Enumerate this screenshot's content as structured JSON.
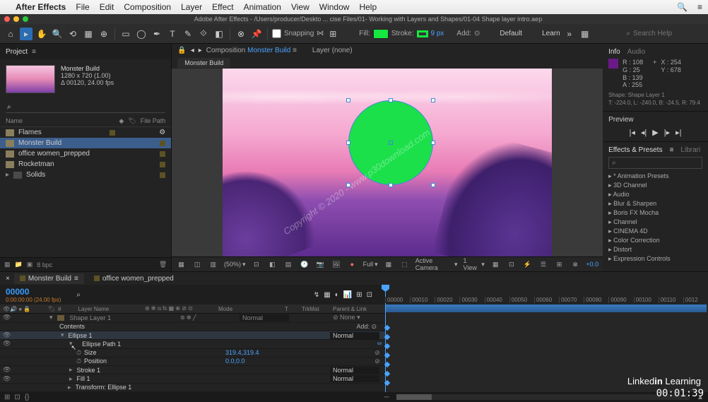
{
  "macos_menu": {
    "app": "After Effects",
    "items": [
      "File",
      "Edit",
      "Composition",
      "Layer",
      "Effect",
      "Animation",
      "View",
      "Window",
      "Help"
    ]
  },
  "title_bar": "Adobe After Effects - /Users/producer/Deskto ... cise Files/01- Working with Layers and Shapes/01-04 Shape layer intro.aep",
  "toolbar": {
    "snapping": "Snapping",
    "fill": "Fill:",
    "stroke": "Stroke:",
    "stroke_px": "9 px",
    "add": "Add:",
    "workspace1": "Default",
    "workspace2": "Learn",
    "search_placeholder": "Search Help"
  },
  "project": {
    "tab": "Project",
    "comp_name": "Monster Build",
    "comp_dims": "1280 x 720 (1.00)",
    "comp_dur": "Δ 00120, 24.00 fps",
    "header_name": "Name",
    "header_path": "File Path",
    "items": [
      {
        "name": "Flames",
        "type": "comp"
      },
      {
        "name": "Monster Build",
        "type": "comp",
        "selected": true
      },
      {
        "name": "office women_prepped",
        "type": "comp"
      },
      {
        "name": "Rocketman",
        "type": "comp"
      },
      {
        "name": "Solids",
        "type": "folder"
      }
    ],
    "footer_bpc": "8 bpc"
  },
  "comp": {
    "tab_prefix": "Composition",
    "tab_name": "Monster Build",
    "layer_tab": "Layer (none)",
    "subtab": "Monster Build",
    "zoom": "(50%)",
    "res": "Full",
    "camera": "Active Camera",
    "views": "1 View",
    "exposure": "+0.0"
  },
  "info": {
    "tabs": [
      "Info",
      "Audio"
    ],
    "r": "R : 108",
    "g": "G : 25",
    "b": "B : 139",
    "a": "A : 255",
    "x": "X : 254",
    "y": "Y : 678",
    "shape": "Shape: Shape Layer 1",
    "coords": "T: -224.0, L: -240.0, B: -24.5, R: 79.4"
  },
  "preview": {
    "label": "Preview"
  },
  "effects": {
    "tabs": [
      "Effects & Presets",
      "Librari"
    ],
    "items": [
      "* Animation Presets",
      "3D Channel",
      "Audio",
      "Blur & Sharpen",
      "Boris FX Mocha",
      "Channel",
      "CINEMA 4D",
      "Color Correction",
      "Distort",
      "Expression Controls"
    ]
  },
  "timeline": {
    "tabs": [
      {
        "name": "Monster Build",
        "active": true
      },
      {
        "name": "office women_prepped",
        "active": false
      }
    ],
    "time": "00000",
    "fps": "0:00:00:00 (24.00 fps)",
    "col_layer": "Layer Name",
    "col_mode": "Mode",
    "col_trkmat": "TrkMat",
    "col_parent": "Parent & Link",
    "ruler": [
      "00000",
      "00010",
      "00020",
      "00030",
      "00040",
      "00050",
      "00060",
      "00070",
      "00080",
      "00090",
      "00100",
      "00110",
      "0012"
    ],
    "rows": [
      {
        "eye": true,
        "indent": 0,
        "arrow": "▾",
        "icon": true,
        "name": "Shape Layer 1",
        "mode": "Normal",
        "parent": "None",
        "dim": true
      },
      {
        "indent": 1,
        "name": "Contents",
        "add": "Add: ⊙"
      },
      {
        "eye": true,
        "indent": 1,
        "arrow": "▾",
        "name": "Ellipse 1",
        "mode": "Normal"
      },
      {
        "eye": true,
        "indent": 2,
        "arrow": "▾",
        "name": "Ellipse Path 1",
        "chain": true
      },
      {
        "indent": 3,
        "stopwatch": true,
        "name": "Size",
        "val": "319.4,319.4",
        "link": "⊘"
      },
      {
        "indent": 3,
        "stopwatch": true,
        "name": "Position",
        "val": "0.0,0.0",
        "link": "⊘"
      },
      {
        "eye": true,
        "indent": 2,
        "arrow": "▸",
        "name": "Stroke 1",
        "mode": "Normal"
      },
      {
        "eye": true,
        "indent": 2,
        "arrow": "▸",
        "name": "Fill 1",
        "mode": "Normal"
      },
      {
        "indent": 2,
        "arrow": "▸",
        "name": "Transform: Ellipse 1"
      }
    ]
  },
  "watermark": {
    "diag": "Copyright © 2020 - www.p30download.com",
    "logo_pre": "Linked",
    "logo_in": "in",
    "logo_post": " Learning",
    "time": "00:01:39"
  }
}
